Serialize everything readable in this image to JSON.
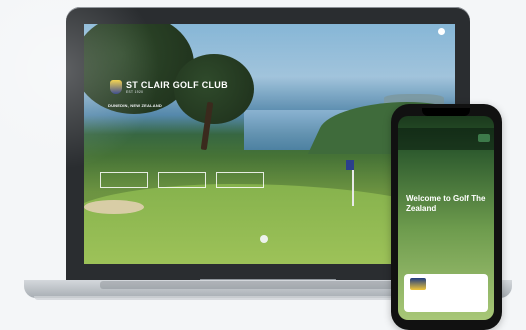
{
  "site": {
    "top_nav": "",
    "brand": {
      "name": "ST CLAIR GOLF CLUB",
      "est": "EST 1920"
    },
    "location": "DUNEDIN, NEW ZEALAND",
    "intro_text": "",
    "intro_text_2": "",
    "buttons": [
      {
        "label": ""
      },
      {
        "label": ""
      },
      {
        "label": ""
      }
    ],
    "scroll_label": ""
  },
  "phone": {
    "logo": "",
    "nav_text": "",
    "tag": "",
    "headline": "Welcome to Golf The Zealand",
    "subtitle": "",
    "card_text": ""
  },
  "colors": {
    "accent_blue": "#2a3b86",
    "accent_gold": "#f3cf3c",
    "grass": "#86b24d",
    "sea": "#4e83ad"
  },
  "icons": [
    "menu-icon",
    "club-crest-icon",
    "scroll-indicator-icon",
    "club-crest-icon"
  ]
}
